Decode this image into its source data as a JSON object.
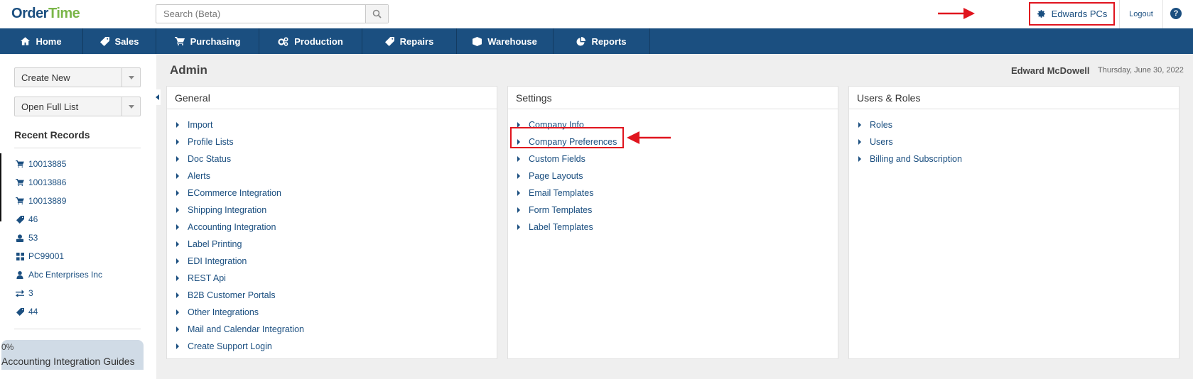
{
  "brand": {
    "logo_o": "O",
    "logo_rder": "rder",
    "logo_time": "Time"
  },
  "search": {
    "placeholder": "Search (Beta)"
  },
  "account": {
    "name": "Edwards PCs",
    "logout": "Logout",
    "help": "?"
  },
  "nav": [
    {
      "label": "Home",
      "icon": "home-icon"
    },
    {
      "label": "Sales",
      "icon": "tag-icon"
    },
    {
      "label": "Purchasing",
      "icon": "cart-icon"
    },
    {
      "label": "Production",
      "icon": "gears-icon"
    },
    {
      "label": "Repairs",
      "icon": "tag-icon"
    },
    {
      "label": "Warehouse",
      "icon": "box-icon"
    },
    {
      "label": "Reports",
      "icon": "pie-chart-icon"
    }
  ],
  "sidebar": {
    "create_new": "Create New",
    "open_full_list": "Open Full List",
    "recent_title": "Recent Records",
    "recent": [
      {
        "label": "10013885",
        "icon": "cart-icon"
      },
      {
        "label": "10013886",
        "icon": "cart-icon"
      },
      {
        "label": "10013889",
        "icon": "cart-icon"
      },
      {
        "label": "46",
        "icon": "tag-icon"
      },
      {
        "label": "53",
        "icon": "inventory-icon"
      },
      {
        "label": "PC99001",
        "icon": "grid-icon"
      },
      {
        "label": "Abc Enterprises Inc",
        "icon": "user-icon"
      },
      {
        "label": "3",
        "icon": "transfer-icon"
      },
      {
        "label": "44",
        "icon": "tag-icon"
      }
    ],
    "progress": {
      "percent": "0%",
      "value": 0,
      "label": "Accounting Integration Guides"
    }
  },
  "page": {
    "title": "Admin",
    "user": "Edward McDowell",
    "date": "Thursday, June 30, 2022"
  },
  "panels": {
    "general": {
      "title": "General",
      "items": [
        "Import",
        "Profile Lists",
        "Doc Status",
        "Alerts",
        "ECommerce Integration",
        "Shipping Integration",
        "Accounting Integration",
        "Label Printing",
        "EDI Integration",
        "REST Api",
        "B2B Customer Portals",
        "Other Integrations",
        "Mail and Calendar Integration",
        "Create Support Login"
      ]
    },
    "settings": {
      "title": "Settings",
      "items": [
        "Company Info",
        "Company Preferences",
        "Custom Fields",
        "Page Layouts",
        "Email Templates",
        "Form Templates",
        "Label Templates"
      ]
    },
    "users": {
      "title": "Users & Roles",
      "items": [
        "Roles",
        "Users",
        "Billing and Subscription"
      ]
    }
  },
  "colors": {
    "brand_blue": "#1b4f80",
    "brand_green": "#7ab648",
    "annotation_red": "#e0141e"
  }
}
